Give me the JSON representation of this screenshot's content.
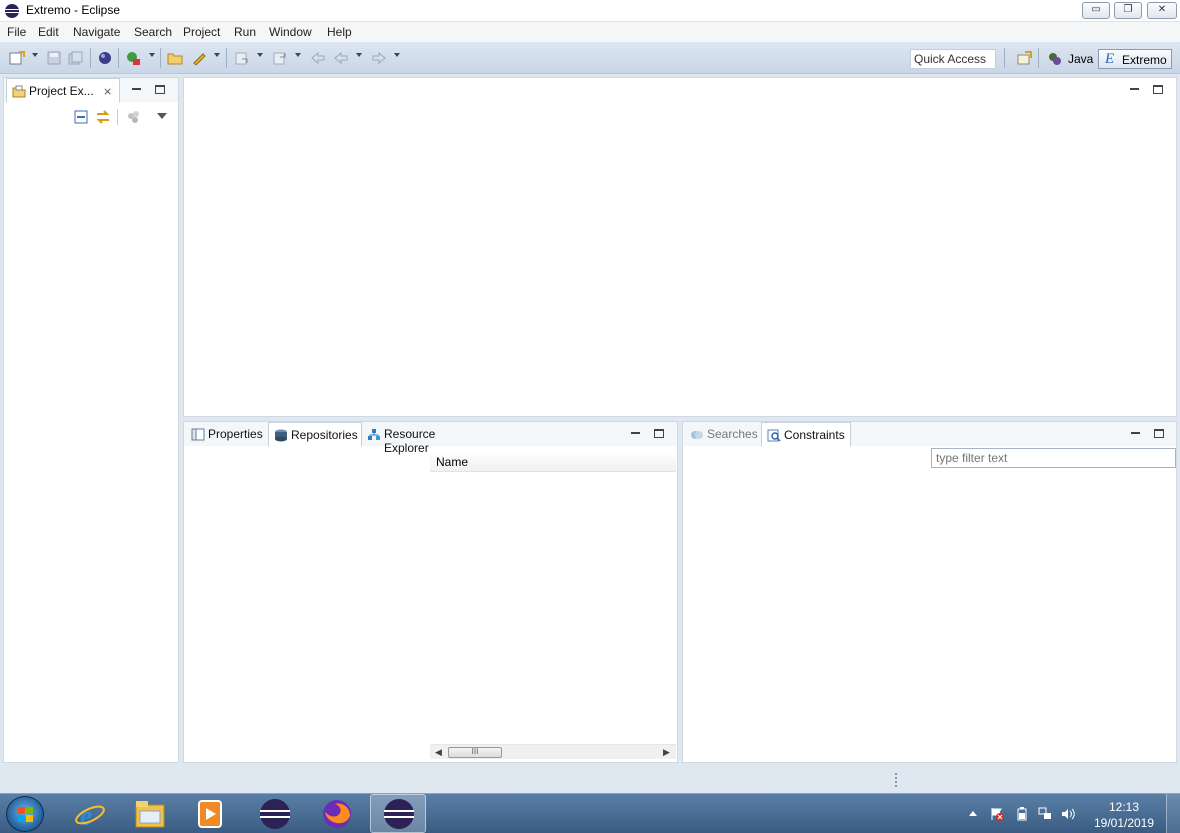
{
  "window": {
    "title": "Extremo - Eclipse",
    "controls": {
      "minimize": "▭",
      "restore": "❐",
      "close": "✕"
    }
  },
  "menu": [
    "File",
    "Edit",
    "Navigate",
    "Search",
    "Project",
    "Run",
    "Window",
    "Help"
  ],
  "toolbar": {
    "quick_access": "Quick Access",
    "perspectives": {
      "java": "Java",
      "extremo": "Extremo"
    }
  },
  "project_explorer": {
    "tab_label": "Project Ex..."
  },
  "properties_panel": {
    "tabs": [
      "Properties",
      "Repositories",
      "Resource Explorer"
    ],
    "active_tab": "Repositories",
    "column_header": "Name",
    "scroll_thumb": "III"
  },
  "searches_panel": {
    "tabs": [
      "Searches",
      "Constraints"
    ],
    "active_tab": "Constraints",
    "filter_placeholder": "type filter text"
  },
  "taskbar": {
    "clock_time": "12:13",
    "clock_date": "19/01/2019"
  },
  "colors": {
    "accent": "#2c2255",
    "toolbar": "#c9d6e6",
    "background": "#dfe7f1",
    "taskbar": "#3a5c82"
  }
}
